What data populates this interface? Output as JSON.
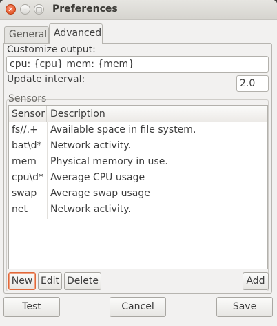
{
  "window": {
    "title": "Preferences",
    "close_glyph": "✕",
    "min_glyph": "–",
    "max_glyph": "□"
  },
  "tabs": {
    "general": "General",
    "advanced": "Advanced"
  },
  "advanced": {
    "customize_label": "Customize output:",
    "customize_value": "cpu: {cpu} mem: {mem}",
    "interval_label": "Update interval:",
    "interval_value": "2.0"
  },
  "sensors": {
    "frame_label": "Sensors",
    "columns": [
      "Sensor",
      "Description"
    ],
    "rows": [
      {
        "sensor": "fs//.+",
        "description": "Available space in file system."
      },
      {
        "sensor": "bat\\d*",
        "description": "Network activity."
      },
      {
        "sensor": "mem",
        "description": "Physical memory in use."
      },
      {
        "sensor": "cpu\\d*",
        "description": "Average CPU usage"
      },
      {
        "sensor": "swap",
        "description": "Average swap usage"
      },
      {
        "sensor": "net",
        "description": "Network activity."
      }
    ],
    "buttons": {
      "new": "New",
      "edit": "Edit",
      "delete": "Delete",
      "add": "Add"
    }
  },
  "footer": {
    "test": "Test",
    "cancel": "Cancel",
    "save": "Save"
  },
  "colors": {
    "accent": "#e0683a",
    "close_button": "#df4a16"
  },
  "icons": [
    "close-icon",
    "minimize-icon",
    "maximize-icon"
  ]
}
